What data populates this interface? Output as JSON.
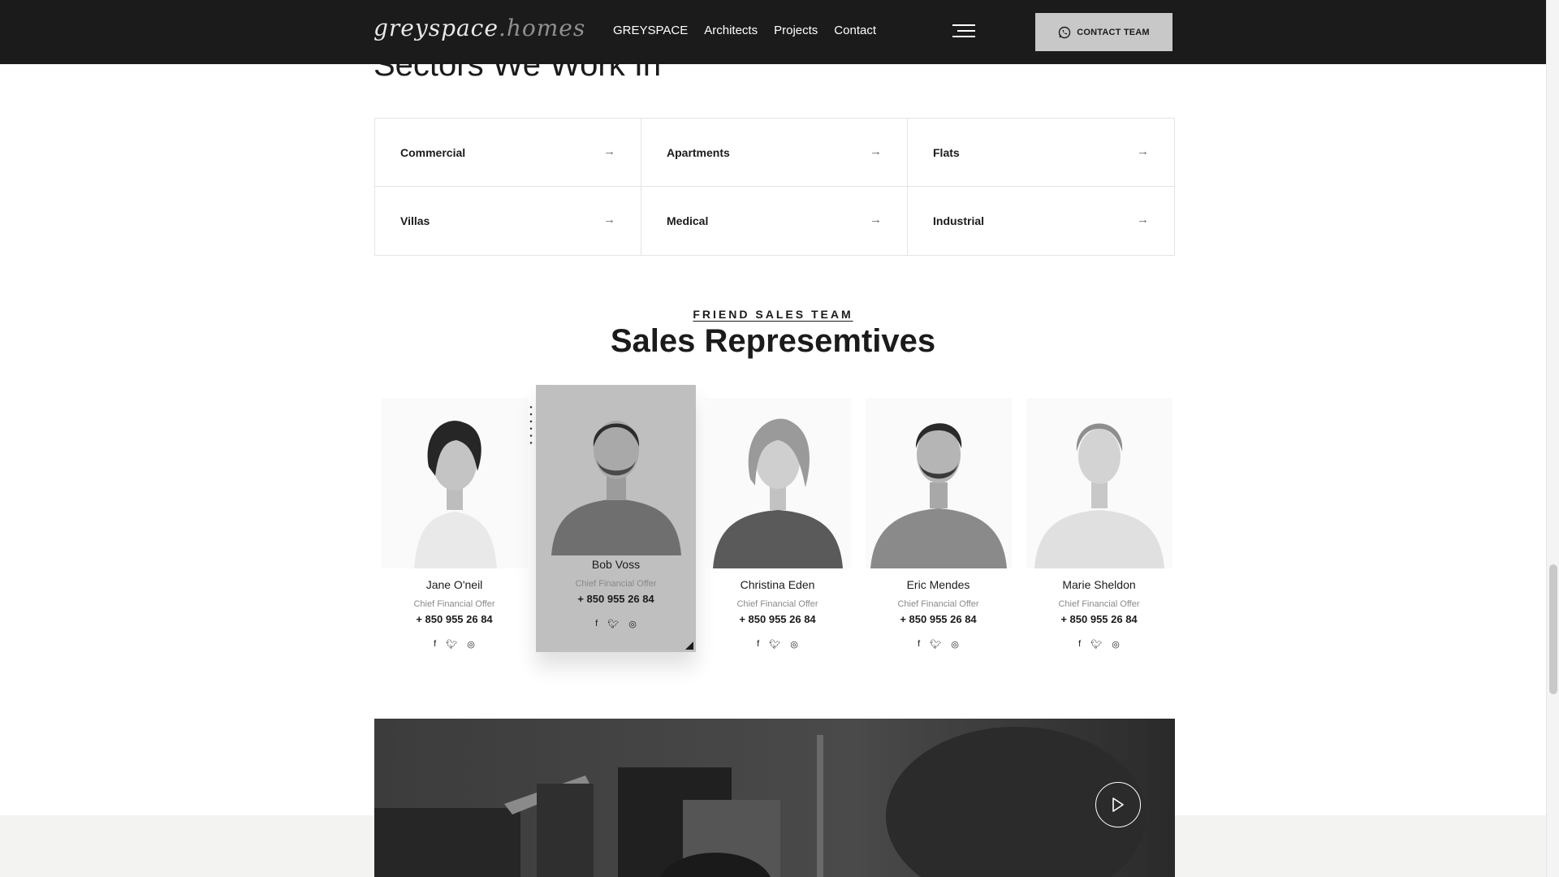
{
  "header": {
    "logo_main": "greyspace",
    "logo_suffix": ".homes",
    "nav": [
      "GREYSPACE",
      "Architects",
      "Projects",
      "Contact"
    ],
    "contact_button": "CONTACT TEAM"
  },
  "sectors": {
    "title": "Sectors We Work In",
    "items": [
      "Commercial",
      "Apartments",
      "Flats",
      "Villas",
      "Medical",
      "Industrial"
    ],
    "arrow": "→"
  },
  "team": {
    "kicker": "FRIEND SALES TEAM",
    "title": "Sales Represemtives",
    "members": [
      {
        "name": "Jane O'neil",
        "role": "Chief Financial Offer",
        "phone": "+ 850 955 26 84"
      },
      {
        "name": "Bob Voss",
        "role": "Chief Financial Offer",
        "phone": "+ 850 955 26 84"
      },
      {
        "name": "Christina Eden",
        "role": "Chief Financial Offer",
        "phone": "+ 850 955 26 84"
      },
      {
        "name": "Eric Mendes",
        "role": "Chief Financial Offer",
        "phone": "+ 850 955 26 84"
      },
      {
        "name": "Marie Sheldon",
        "role": "Chief Financial Offer",
        "phone": "+ 850 955 26 84"
      }
    ],
    "social_icons": [
      "facebook-icon",
      "twitter-icon",
      "instagram-icon"
    ]
  },
  "video": {
    "icon": "play-icon"
  }
}
